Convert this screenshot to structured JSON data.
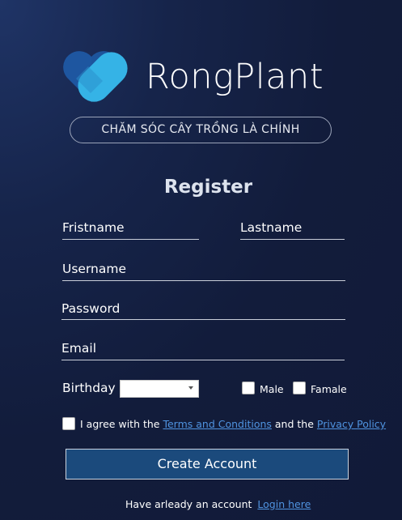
{
  "brand": {
    "name": "RongPlant",
    "tagline": "CHĂM SÓC CÂY TRỒNG LÀ CHÍNH"
  },
  "form": {
    "title": "Register",
    "firstname_placeholder": "Fristname",
    "lastname_placeholder": "Lastname",
    "username_placeholder": "Username",
    "password_placeholder": "Password",
    "email_placeholder": "Email",
    "birthday_label": "Birthday",
    "birthday_value": "",
    "male_label": "Male",
    "female_label": "Famale",
    "agree_prefix": "I agree with the",
    "terms_link": "Terms and Conditions",
    "agree_middle": "and the",
    "privacy_link": "Privacy Policy",
    "submit_label": "Create Account",
    "login_prompt": "Have arleady an account",
    "login_link": "Login here"
  },
  "colors": {
    "background": "#121c3b",
    "button": "#1b4a7c",
    "link": "#4f93e0",
    "logo_dark": "#1e56a0",
    "logo_light": "#35b3e6"
  }
}
